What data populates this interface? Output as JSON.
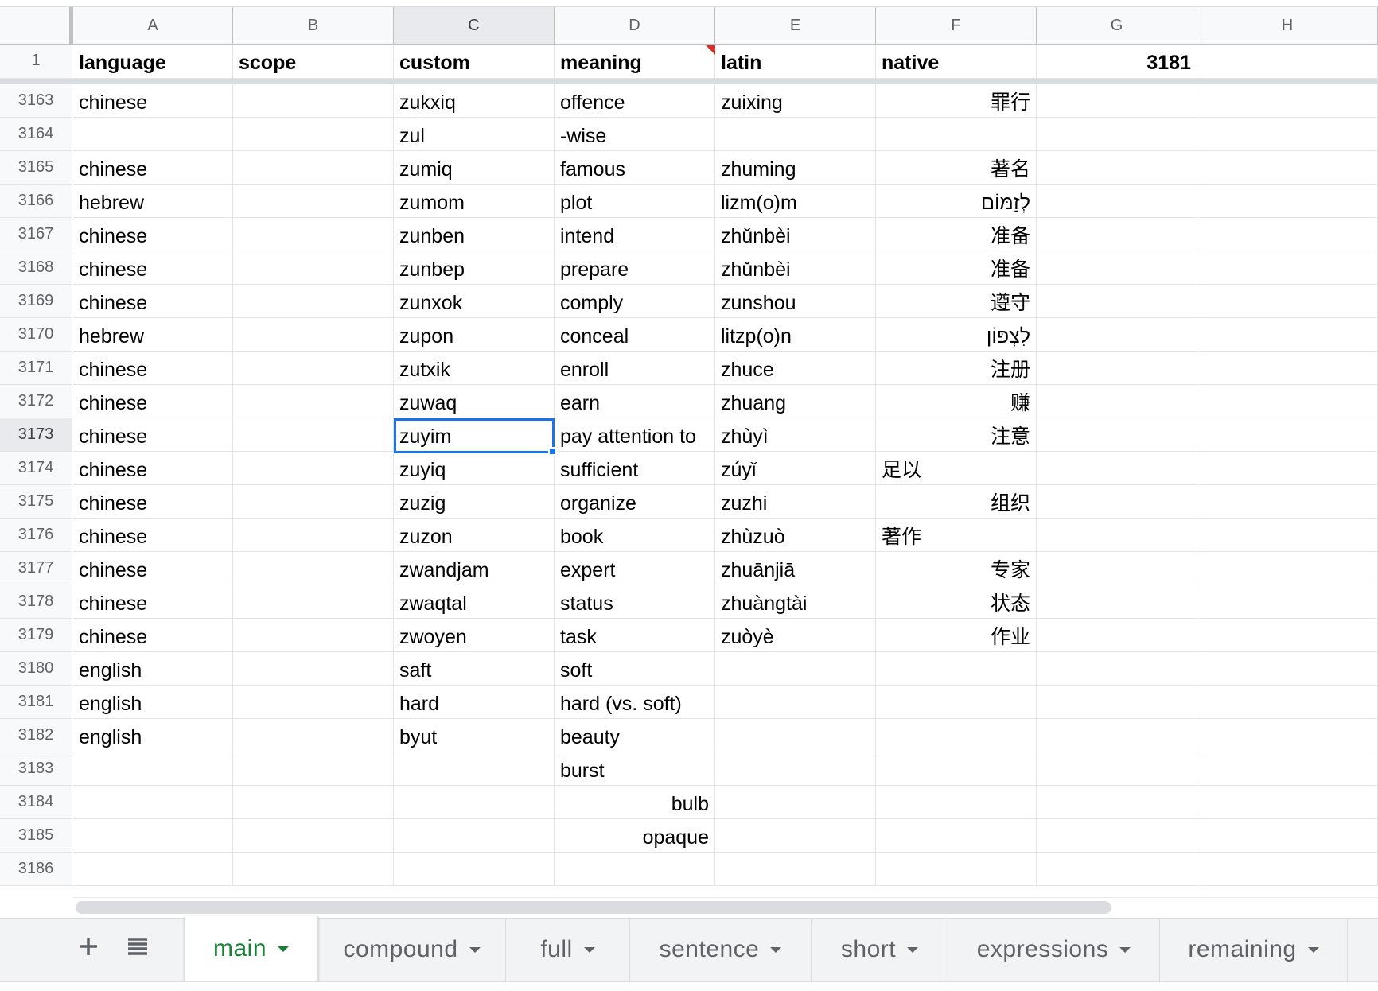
{
  "columns": [
    "A",
    "B",
    "C",
    "D",
    "E",
    "F",
    "G",
    "H"
  ],
  "selected_column": "C",
  "header_row": {
    "row_number": "1",
    "cells": [
      "language",
      "scope",
      "custom",
      "meaning",
      "latin",
      "native",
      "3181",
      ""
    ]
  },
  "rows": [
    {
      "n": "3163",
      "language": "chinese",
      "scope": "",
      "custom": "zukxiq",
      "meaning": "offence",
      "latin": "zuixing",
      "native": "罪行"
    },
    {
      "n": "3164",
      "language": "",
      "scope": "",
      "custom": "zul",
      "meaning": "-wise",
      "latin": "",
      "native": ""
    },
    {
      "n": "3165",
      "language": "chinese",
      "scope": "",
      "custom": "zumiq",
      "meaning": "famous",
      "latin": "zhuming",
      "native": "著名"
    },
    {
      "n": "3166",
      "language": "hebrew",
      "scope": "",
      "custom": "zumom",
      "meaning": "plot",
      "latin": "lizm(o)m",
      "native": "לְזַמּוֹם"
    },
    {
      "n": "3167",
      "language": "chinese",
      "scope": "",
      "custom": "zunben",
      "meaning": "intend",
      "latin": "zhǔnbèi",
      "native": "准备"
    },
    {
      "n": "3168",
      "language": "chinese",
      "scope": "",
      "custom": "zunbep",
      "meaning": "prepare",
      "latin": "zhǔnbèi",
      "native": "准备"
    },
    {
      "n": "3169",
      "language": "chinese",
      "scope": "",
      "custom": "zunxok",
      "meaning": "comply",
      "latin": "zunshou",
      "native": "遵守"
    },
    {
      "n": "3170",
      "language": "hebrew",
      "scope": "",
      "custom": "zupon",
      "meaning": "conceal",
      "latin": "litzp(o)n",
      "native": "לִצְפּוֹן"
    },
    {
      "n": "3171",
      "language": "chinese",
      "scope": "",
      "custom": "zutxik",
      "meaning": "enroll",
      "latin": "zhuce",
      "native": "注册"
    },
    {
      "n": "3172",
      "language": "chinese",
      "scope": "",
      "custom": "zuwaq",
      "meaning": "earn",
      "latin": "zhuang",
      "native": "赚"
    },
    {
      "n": "3173",
      "language": "chinese",
      "scope": "",
      "custom": "zuyim",
      "meaning": "pay attention to",
      "latin": "zhùyì",
      "native": "注意"
    },
    {
      "n": "3174",
      "language": "chinese",
      "scope": "",
      "custom": "zuyiq",
      "meaning": "sufficient",
      "latin": "zúyǐ",
      "native": "足以"
    },
    {
      "n": "3175",
      "language": "chinese",
      "scope": "",
      "custom": "zuzig",
      "meaning": "organize",
      "latin": "zuzhi",
      "native": "组织"
    },
    {
      "n": "3176",
      "language": "chinese",
      "scope": "",
      "custom": "zuzon",
      "meaning": "book",
      "latin": "zhùzuò",
      "native": "著作"
    },
    {
      "n": "3177",
      "language": "chinese",
      "scope": "",
      "custom": "zwandjam",
      "meaning": "expert",
      "latin": "zhuānjiā",
      "native": "专家"
    },
    {
      "n": "3178",
      "language": "chinese",
      "scope": "",
      "custom": "zwaqtal",
      "meaning": "status",
      "latin": "zhuàngtài",
      "native": "状态"
    },
    {
      "n": "3179",
      "language": "chinese",
      "scope": "",
      "custom": "zwoyen",
      "meaning": "task",
      "latin": "zuòyè",
      "native": "作业"
    },
    {
      "n": "3180",
      "language": "english",
      "scope": "",
      "custom": "saft",
      "meaning": "soft",
      "latin": "",
      "native": ""
    },
    {
      "n": "3181",
      "language": "english",
      "scope": "",
      "custom": "hard",
      "meaning": "hard (vs. soft)",
      "latin": "",
      "native": ""
    },
    {
      "n": "3182",
      "language": "english",
      "scope": "",
      "custom": "byut",
      "meaning": "beauty",
      "latin": "",
      "native": ""
    },
    {
      "n": "3183",
      "language": "",
      "scope": "",
      "custom": "",
      "meaning": "burst",
      "latin": "",
      "native": ""
    },
    {
      "n": "3184",
      "language": "",
      "scope": "",
      "custom": "",
      "meaning": "bulb",
      "latin": "",
      "native": ""
    },
    {
      "n": "3185",
      "language": "",
      "scope": "",
      "custom": "",
      "meaning": "opaque",
      "latin": "",
      "native": ""
    },
    {
      "n": "3186",
      "language": "",
      "scope": "",
      "custom": "",
      "meaning": "",
      "latin": "",
      "native": ""
    }
  ],
  "selected_cell": {
    "row": "3173",
    "column": "C"
  },
  "tabs": {
    "add_icon": "plus-icon",
    "list_icon": "all-sheets-icon",
    "items": [
      {
        "label": "main",
        "active": true
      },
      {
        "label": "compound",
        "active": false
      },
      {
        "label": "full",
        "active": false
      },
      {
        "label": "sentence",
        "active": false
      },
      {
        "label": "short",
        "active": false
      },
      {
        "label": "expressions",
        "active": false
      },
      {
        "label": "remaining",
        "active": false
      }
    ]
  },
  "colors": {
    "selection": "#1a73e8",
    "active_tab": "#188038",
    "note_marker": "#d93025"
  }
}
